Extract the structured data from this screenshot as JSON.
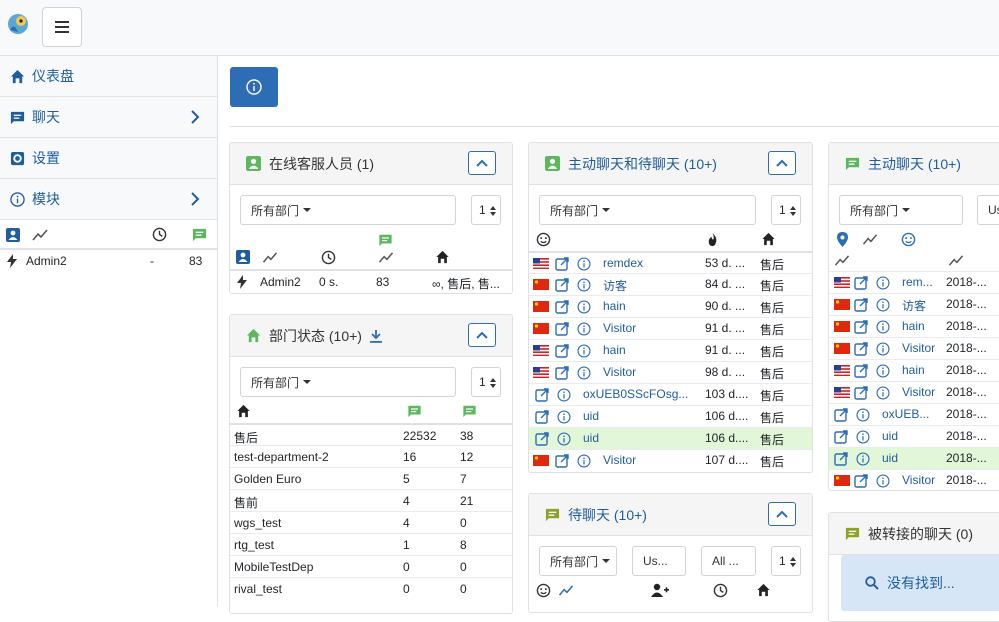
{
  "sidebar": {
    "items": [
      {
        "label": "仪表盘",
        "icon": "home-icon"
      },
      {
        "label": "聊天",
        "icon": "chat-icon"
      },
      {
        "label": "设置",
        "icon": "cog-icon"
      },
      {
        "label": "模块",
        "icon": "info-icon"
      }
    ],
    "operators": [
      {
        "name": "Admin2",
        "time": "-",
        "chats": "83"
      }
    ]
  },
  "online_operators": {
    "title": "在线客服人员 (1)",
    "department": "所有部门",
    "page": "1",
    "badge": "83",
    "rows": [
      {
        "name": "Admin2",
        "time": "0 s.",
        "chats": "83",
        "departments": "∞, 售后, 售..."
      }
    ]
  },
  "department_status": {
    "title": "部门状态 (10+)",
    "department": "所有部门",
    "page": "1",
    "rows": [
      {
        "name": "售后",
        "a": "22532",
        "b": "38"
      },
      {
        "name": "test-department-2",
        "a": "16",
        "b": "12"
      },
      {
        "name": "Golden Euro",
        "a": "5",
        "b": "7"
      },
      {
        "name": "售前",
        "a": "4",
        "b": "21"
      },
      {
        "name": "wgs_test",
        "a": "4",
        "b": "0"
      },
      {
        "name": "rtg_test",
        "a": "1",
        "b": "8"
      },
      {
        "name": "MobileTestDep",
        "a": "0",
        "b": "0"
      },
      {
        "name": "rival_test",
        "a": "0",
        "b": "0"
      }
    ]
  },
  "active_pending": {
    "title": "主动聊天和待聊天 (10+)",
    "department": "所有部门",
    "page": "1",
    "rows": [
      {
        "flag": "us",
        "name": "remdex",
        "time": "53 d. ...",
        "dep": "售后",
        "hl": false
      },
      {
        "flag": "cn",
        "name": "访客",
        "time": "84 d. ...",
        "dep": "售后",
        "hl": false
      },
      {
        "flag": "cn",
        "name": "hain",
        "time": "90 d. ...",
        "dep": "售后",
        "hl": false
      },
      {
        "flag": "cn",
        "name": "Visitor",
        "time": "91 d. ...",
        "dep": "售后",
        "hl": false
      },
      {
        "flag": "us",
        "name": "hain",
        "time": "91 d. ...",
        "dep": "售后",
        "hl": false
      },
      {
        "flag": "us",
        "name": "Visitor",
        "time": "98 d. ...",
        "dep": "售后",
        "hl": false
      },
      {
        "flag": "",
        "name": "oxUEB0SScFOsg...",
        "time": "103 d....",
        "dep": "售后",
        "hl": false
      },
      {
        "flag": "",
        "name": "uid",
        "time": "106 d....",
        "dep": "售后",
        "hl": false
      },
      {
        "flag": "",
        "name": "uid",
        "time": "106 d....",
        "dep": "售后",
        "hl": true
      },
      {
        "flag": "cn",
        "name": "Visitor",
        "time": "107 d....",
        "dep": "售后",
        "hl": false
      }
    ]
  },
  "pending": {
    "title": "待聊天 (10+)",
    "department": "所有部门",
    "user": "Us...",
    "all": "All ...",
    "page": "1"
  },
  "active": {
    "title": "主动聊天 (10+)",
    "department": "所有部门",
    "user": "Us",
    "rows": [
      {
        "flag": "us",
        "name": "rem...",
        "time": "2018-...",
        "hl": false
      },
      {
        "flag": "cn",
        "name": "访客",
        "time": "2018-...",
        "hl": false
      },
      {
        "flag": "cn",
        "name": "hain",
        "time": "2018-...",
        "hl": false
      },
      {
        "flag": "cn",
        "name": "Visitor",
        "time": "2018-...",
        "hl": false
      },
      {
        "flag": "us",
        "name": "hain",
        "time": "2018-...",
        "hl": false
      },
      {
        "flag": "us",
        "name": "Visitor",
        "time": "2018-...",
        "hl": false
      },
      {
        "flag": "",
        "name": "oxUEB...",
        "time": "2018-...",
        "hl": false
      },
      {
        "flag": "",
        "name": "uid",
        "time": "2018-...",
        "hl": false
      },
      {
        "flag": "",
        "name": "uid",
        "time": "2018-...",
        "hl": true
      },
      {
        "flag": "cn",
        "name": "Visitor",
        "time": "2018-...",
        "hl": false
      }
    ]
  },
  "transferred": {
    "title": "被转接的聊天 (0)",
    "empty": "没有找到..."
  },
  "colors": {
    "accent": "#2d6db5",
    "link": "#1f5d9c",
    "green": "#5cb85c",
    "highlight": "#e2f6d8"
  }
}
